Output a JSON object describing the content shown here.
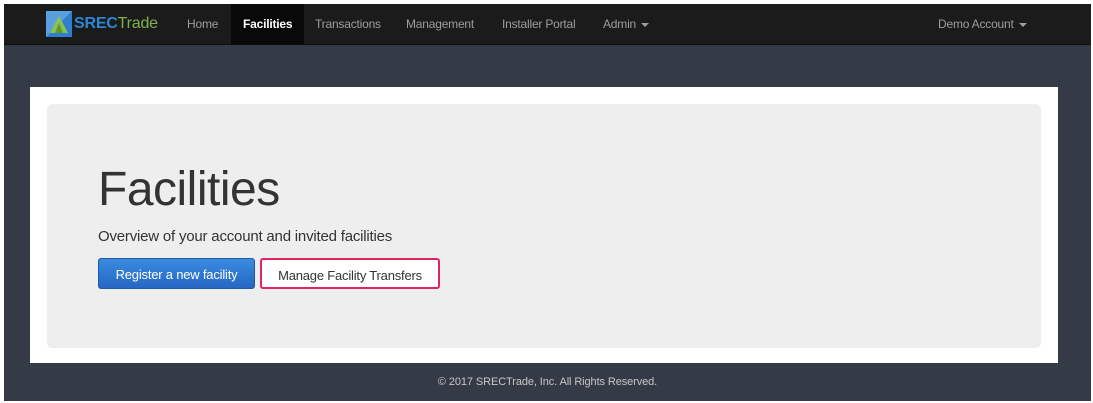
{
  "brand": {
    "part1": "SREC",
    "part2": "Trade"
  },
  "nav": {
    "items": [
      {
        "label": "Home"
      },
      {
        "label": "Facilities"
      },
      {
        "label": "Transactions"
      },
      {
        "label": "Management"
      },
      {
        "label": "Installer Portal"
      },
      {
        "label": "Admin"
      }
    ],
    "account": "Demo Account"
  },
  "main": {
    "title": "Facilities",
    "subtitle": "Overview of your account and invited facilities",
    "register_button": "Register a new facility",
    "transfers_button": "Manage Facility Transfers"
  },
  "footer": {
    "text": "© 2017 SRECTrade, Inc. All Rights Reserved."
  },
  "colors": {
    "navbar": "#1b1b1b",
    "page_bg": "#343a46",
    "primary": "#2a72cf",
    "highlight": "#e0245e"
  }
}
